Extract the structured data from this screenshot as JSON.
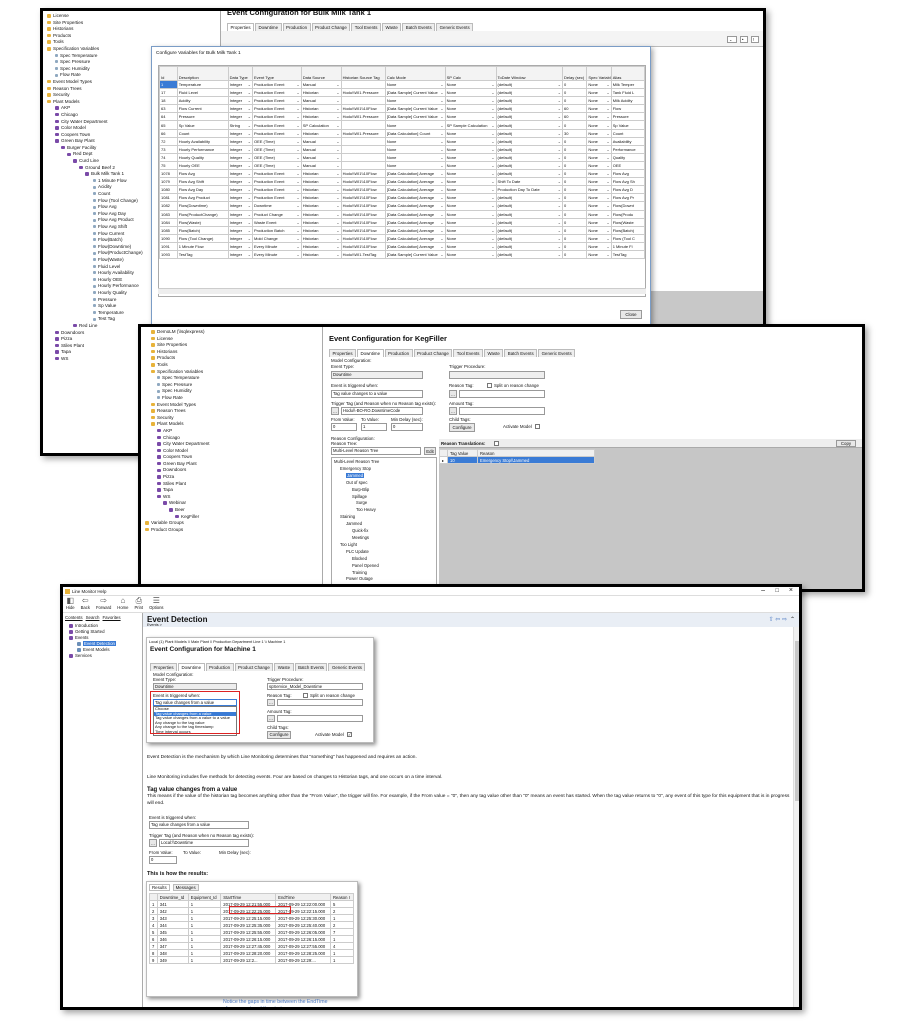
{
  "s1": {
    "heading": "Event Configuration for Bulk Milk Tank 1",
    "tabs": [
      "Properties",
      "Downtime",
      "Production",
      "Product Change",
      "Tool Events",
      "Waste",
      "Batch Events",
      "Generic Events"
    ],
    "dialog_title": "Configure Variables for Bulk Milk Tank 1",
    "close_label": "Close",
    "tree": [
      "License",
      "Site Properties",
      "Historians",
      "Products",
      "Tools",
      "Specification Variables",
      "Spec Temperature",
      "Spec Pressure",
      "Spec Humidity",
      "Flow Rate",
      "Event Model Types",
      "Reason Trees",
      "Security",
      "Plant Models",
      "AKP",
      "Chicago",
      "City Water Department",
      "Color Model",
      "Coopers Town",
      "Green Bay Plant",
      "Burger Facility",
      "Red Dept",
      "Curd Line",
      "Ground Beef 2",
      "Bulk Milk Tank 1",
      "1 Minute Flow",
      "Acidity",
      "Count",
      "Flow (Tool Change)",
      "Flow Avg",
      "Flow Avg Day",
      "Flow Avg Product",
      "Flow Avg Shift",
      "Flow Current",
      "Flow(Batch)",
      "Flow(Downtime)",
      "Flow(ProductChange)",
      "Flow(Waste)",
      "Fluid Level",
      "Hourly Availability",
      "Hourly OEE",
      "Hourly Performance",
      "Hourly Quality",
      "Pressure",
      "Sp Value",
      "Temperature",
      "Test Tag",
      "Red Line",
      "Downdoors",
      "Pizza",
      "Stiles Plant",
      "Tapa",
      "WS"
    ],
    "columns": [
      "Id",
      "Description",
      "Data Type",
      "Event Type",
      "Data Source",
      "Historian Source Tag",
      "Calc Mode",
      "SP Calc",
      "ToDate Window",
      "Delay (sec)",
      "Spec Variable",
      "Alias"
    ],
    "rows": [
      [
        "1",
        "Temperature",
        "Integer",
        "Production Event",
        "Manual",
        "",
        "None",
        "None",
        "(default)",
        "0",
        "None",
        "Milk Temper"
      ],
      [
        "17",
        "Fluid Level",
        "Integer",
        "Production Event",
        "Historian",
        "Hodu\\\\WI1.Pressure",
        "[Data Sample] Current Value",
        "None",
        "(default)",
        "0",
        "None",
        "Tank Fluid L"
      ],
      [
        "18",
        "Acidity",
        "Integer",
        "Production Event",
        "Manual",
        "",
        "None",
        "None",
        "(default)",
        "0",
        "None",
        "Milk Acidity"
      ],
      [
        "63",
        "Flow Current",
        "Integer",
        "Production Event",
        "Historian",
        "Hodu\\\\WI1\\\\10Flow",
        "[Data Sample] Current Value",
        "None",
        "(default)",
        "60",
        "None",
        "Flow"
      ],
      [
        "64",
        "Pressure",
        "Integer",
        "Production Event",
        "Historian",
        "Hodu\\\\WI1.Pressure",
        "[Data Sample] Current Value",
        "None",
        "(default)",
        "60",
        "None",
        "Pressure"
      ],
      [
        "65",
        "Sp Value",
        "String",
        "Production Event",
        "SP Calculation",
        "",
        "None",
        "SP Sample Calculation",
        "(default)",
        "0",
        "None",
        "Sp Value"
      ],
      [
        "66",
        "Count",
        "Integer",
        "Production Event",
        "Historian",
        "Hodu\\\\WI1.Pressure",
        "[Data Calculation] Count",
        "None",
        "(default)",
        "30",
        "None",
        "Count"
      ],
      [
        "72",
        "Hourly Availability",
        "Integer",
        "OEE (Time)",
        "Manual",
        "",
        "None",
        "None",
        "(default)",
        "0",
        "None",
        "Availability"
      ],
      [
        "73",
        "Hourly Performance",
        "Integer",
        "OEE (Time)",
        "Manual",
        "",
        "None",
        "None",
        "(default)",
        "0",
        "None",
        "Performance"
      ],
      [
        "74",
        "Hourly Quality",
        "Integer",
        "OEE (Time)",
        "Manual",
        "",
        "None",
        "None",
        "(default)",
        "0",
        "None",
        "Quality"
      ],
      [
        "75",
        "Hourly OEE",
        "Integer",
        "OEE (Time)",
        "Manual",
        "",
        "None",
        "None",
        "(default)",
        "0",
        "None",
        "OEE"
      ],
      [
        "1078",
        "Flow Avg",
        "Integer",
        "Production Event",
        "Historian",
        "Hodu\\\\WI1\\\\10Flow",
        "[Data Calculation] Average",
        "None",
        "(default)",
        "0",
        "None",
        "Flow Avg"
      ],
      [
        "1079",
        "Flow Avg Shift",
        "Integer",
        "Production Event",
        "Historian",
        "Hodu\\\\WI1\\\\10Flow",
        "[Data Calculation] Average",
        "None",
        "Shift To Date",
        "0",
        "None",
        "Flow Avg Sh"
      ],
      [
        "1080",
        "Flow Avg Day",
        "Integer",
        "Production Event",
        "Historian",
        "Hodu\\\\WI1\\\\10Flow",
        "[Data Calculation] Average",
        "None",
        "Production Day To Date",
        "0",
        "None",
        "Flow Avg D"
      ],
      [
        "1081",
        "Flow Avg Product",
        "Integer",
        "Production Event",
        "Historian",
        "Hodu\\\\WI1\\\\10Flow",
        "[Data Calculation] Average",
        "None",
        "(default)",
        "0",
        "None",
        "Flow Avg Pr"
      ],
      [
        "1082",
        "Flow(Downtime)",
        "Integer",
        "Downtime",
        "Historian",
        "Hodu\\\\WI1\\\\10Flow",
        "[Data Calculation] Average",
        "None",
        "(default)",
        "0",
        "None",
        "Flow(Downt"
      ],
      [
        "1083",
        "Flow(ProductChange)",
        "Integer",
        "Product Change",
        "Historian",
        "Hodu\\\\WI1\\\\10Flow",
        "[Data Calculation] Average",
        "None",
        "(default)",
        "0",
        "None",
        "Flow(Produ"
      ],
      [
        "1084",
        "Flow(Waste)",
        "Integer",
        "Waste Event",
        "Historian",
        "Hodu\\\\WI1\\\\10Flow",
        "[Data Calculation] Average",
        "None",
        "(default)",
        "0",
        "None",
        "Flow(Waste"
      ],
      [
        "1085",
        "Flow(Batch)",
        "Integer",
        "Production Batch",
        "Historian",
        "Hodu\\\\WI1\\\\10Flow",
        "[Data Calculation] Average",
        "None",
        "(default)",
        "0",
        "None",
        "Flow(Batch)"
      ],
      [
        "1090",
        "Flow (Tool Change)",
        "Integer",
        "Mold Change",
        "Historian",
        "Hodu\\\\WI1\\\\10Flow",
        "[Data Calculation] Average",
        "None",
        "(default)",
        "0",
        "None",
        "Flow (Tool C"
      ],
      [
        "1091",
        "1 Minute Flow",
        "Integer",
        "Every Minute",
        "Historian",
        "Hodu\\\\WI1\\\\10Flow",
        "[Data Calculation] Average",
        "None",
        "(default)",
        "0",
        "None",
        "1 Minute Fl"
      ],
      [
        "1093",
        "TestTag",
        "Integer",
        "Every Minute",
        "Historian",
        "Hodu\\\\WI1.TestTag",
        "[Data Sample] Current Value",
        "None",
        "(default)",
        "0",
        "None",
        "TestTag"
      ]
    ]
  },
  "s2": {
    "heading": "Event Configuration for KegFiller",
    "tabs": [
      "Properties",
      "Downtime",
      "Production",
      "Product Change",
      "Tool Events",
      "Waste",
      "Batch Events",
      "Generic Events"
    ],
    "tree": [
      "DemoLM (\\\\sqlexpress)",
      "License",
      "Site Properties",
      "Historians",
      "Products",
      "Tools",
      "Specification Variables",
      "Spec Temperature",
      "Spec Pressure",
      "Spec Humidity",
      "Flow Rate",
      "Event Model Types",
      "Reason Trees",
      "Security",
      "Plant Models",
      "AKP",
      "Chicago",
      "City Water Department",
      "Color Model",
      "Coopers Town",
      "Green Bay Plant",
      "Downdoors",
      "Pizza",
      "Stiles Plant",
      "Tapa",
      "WS",
      "Webinar",
      "Beer",
      "KegFiller",
      "Variable Groups",
      "Product Groups"
    ],
    "model_config": "Model Configuration:",
    "event_type_label": "Event Type:",
    "event_type_value": "Downtime",
    "triggered_label": "Event is triggered when:",
    "triggered_value": "Tag value changes to a value",
    "trigger_tag_label": "Trigger Tag (and Reason when no Reason tag exists):",
    "trigger_tag_value": "Hodu\\\\-BO-RO.DowntimeCode",
    "from_label": "From Value:",
    "from_value": "0",
    "to_label": "To Value:",
    "to_value": "1",
    "delay_label": "Min Delay (sec):",
    "delay_value": "0",
    "trigger_proc_label": "Trigger Procedure:",
    "reason_tag_label": "Reason Tag:",
    "split_label": "Split on reason change",
    "amount_tag_label": "Amount Tag:",
    "child_tags_label": "Child Tags:",
    "configure_label": "Configure",
    "activate_label": "Activate Model",
    "reason_config_label": "Reason Configuration:",
    "reason_tree_label": "Reason Tree:",
    "reason_tree_value": "Multi-Level Reason Tree",
    "edit_label": "Edit",
    "translations_label": "Reason Translations:",
    "copy_label": "Copy",
    "trans_cols": [
      "Tag Value",
      "Reason"
    ],
    "trans_row": [
      "10",
      "Emergency Stop\\\\Jammed"
    ],
    "reason_tree": [
      "Multi-Level Reason Tree",
      "Emergency Stop",
      "Jammed",
      "Out of spec",
      "Burp-Blip",
      "Spillage",
      "Surge",
      "Too Heavy",
      "Staining",
      "Jammed",
      "Quick-fix",
      "Meetings",
      "Too Light",
      "PLC Update",
      "Blocked",
      "Panel Opened",
      "Training",
      "Power Outage"
    ]
  },
  "s3": {
    "window_title": "Line Monitor Help",
    "toolbar": [
      "Hide",
      "Back",
      "Forward",
      "Home",
      "Print",
      "Options"
    ],
    "nav_tabs": [
      "Contents",
      "Search",
      "Favorites"
    ],
    "toc": [
      "Introduction",
      "Getting Started",
      "Events",
      "Event Detection",
      "Event Models",
      "Services"
    ],
    "page_title": "Event Detection",
    "crumb": "Events >",
    "inner_path": "Local (1) Plant Models \\\\ Main Plant \\\\ Production Department Line 1 \\\\ Machine 1",
    "inner_heading": "Event Configuration for Machine 1",
    "inner_tabs": [
      "Properties",
      "Downtime",
      "Production",
      "Product Change",
      "Waste",
      "Batch Events",
      "Generic Events"
    ],
    "model_config": "Model Configuration:",
    "event_type_label": "Event Type:",
    "event_type_value": "Downtime",
    "triggered_label": "Event is triggered when:",
    "triggered_value": "Tag value changes from a value",
    "dropdown_options": [
      "Choose",
      "Tag value changes from a value",
      "Tag value changes from a value to a value",
      "Any change to the tag value",
      "Any change to the tag timestamp",
      "Time interval occurs"
    ],
    "trigger_proc_label": "Trigger Procedure:",
    "trigger_proc_value": "spService_Model_Downtime",
    "reason_tag_label": "Reason Tag:",
    "split_label": "Split on reason change",
    "amount_tag_label": "Amount Tag:",
    "child_tags_label": "Child Tags:",
    "configure_label": "Configure",
    "activate_label": "Activate Model",
    "p1": "Event Detection is the mechanism by which Line Monitoring determines that \"something\" has happened and requires an action.",
    "p2": "Line Monitoring includes five methods for detecting events.  Four are based on changes to Historian tags, and one occurs on a time interval.",
    "h2": "Tag value changes from a value",
    "p3": "This means if the value of the historian tag becomes anything other than the \"From Value\", the trigger will fire.  For example, if the From value = \"0\", then any tag value other than \"0\" means an event has started.  When the tag value returns to \"0\", any event of this type for this equipment that is in progress will end.",
    "ex_triggered_label": "Event is triggered when:",
    "ex_triggered_value": "Tag value changes from a value",
    "ex_trigger_tag_label": "Trigger Tag (and Reason when no Reason tag exists):",
    "ex_trigger_tag_value": "Local:\\\\Downtime",
    "ex_from_label": "From Value:",
    "ex_from_value": "0",
    "ex_to_label": "To Value:",
    "ex_delay_label": "Min Delay (sec):",
    "results_heading": "This is how the results:",
    "results_tabs": [
      "Results",
      "Messages"
    ],
    "results_cols": [
      "",
      "Downtime_Id",
      "Equipment_Id",
      "StartTime",
      "EndTime",
      "Reason I"
    ],
    "results_rows": [
      [
        "1",
        "341",
        "1",
        "2017-09-29 12:21:55.000",
        "2017-09-29 12:22:00.000",
        "5"
      ],
      [
        "2",
        "342",
        "1",
        "2017-09-29 12:22:25.000",
        "2017-09-29 12:22:15.000",
        "2"
      ],
      [
        "3",
        "343",
        "1",
        "2017-09-29 12:25:15.000",
        "2017-09-29 12:25:30.000",
        "1"
      ],
      [
        "4",
        "344",
        "1",
        "2017-09-29 12:25:35.000",
        "2017-09-29 12:25:40.000",
        "2"
      ],
      [
        "5",
        "345",
        "1",
        "2017-09-29 12:25:55.000",
        "2017-09-29 12:26:05.000",
        "7"
      ],
      [
        "6",
        "346",
        "1",
        "2017-09-29 12:26:15.000",
        "2017-09-29 12:26:15.000",
        "1"
      ],
      [
        "7",
        "347",
        "1",
        "2017-09-29 12:27:45.000",
        "2017-09-29 12:27:55.000",
        "4"
      ],
      [
        "8",
        "348",
        "1",
        "2017-09-29 12:28:20.000",
        "2017-09-29 12:28:25.000",
        "1"
      ],
      [
        "9",
        "349",
        "1",
        "2017-09-29 12:2...",
        "2017-09-29 12:29:...",
        "1"
      ]
    ],
    "note": "Notice the gaps in time between the EndTime of one event and the start"
  }
}
